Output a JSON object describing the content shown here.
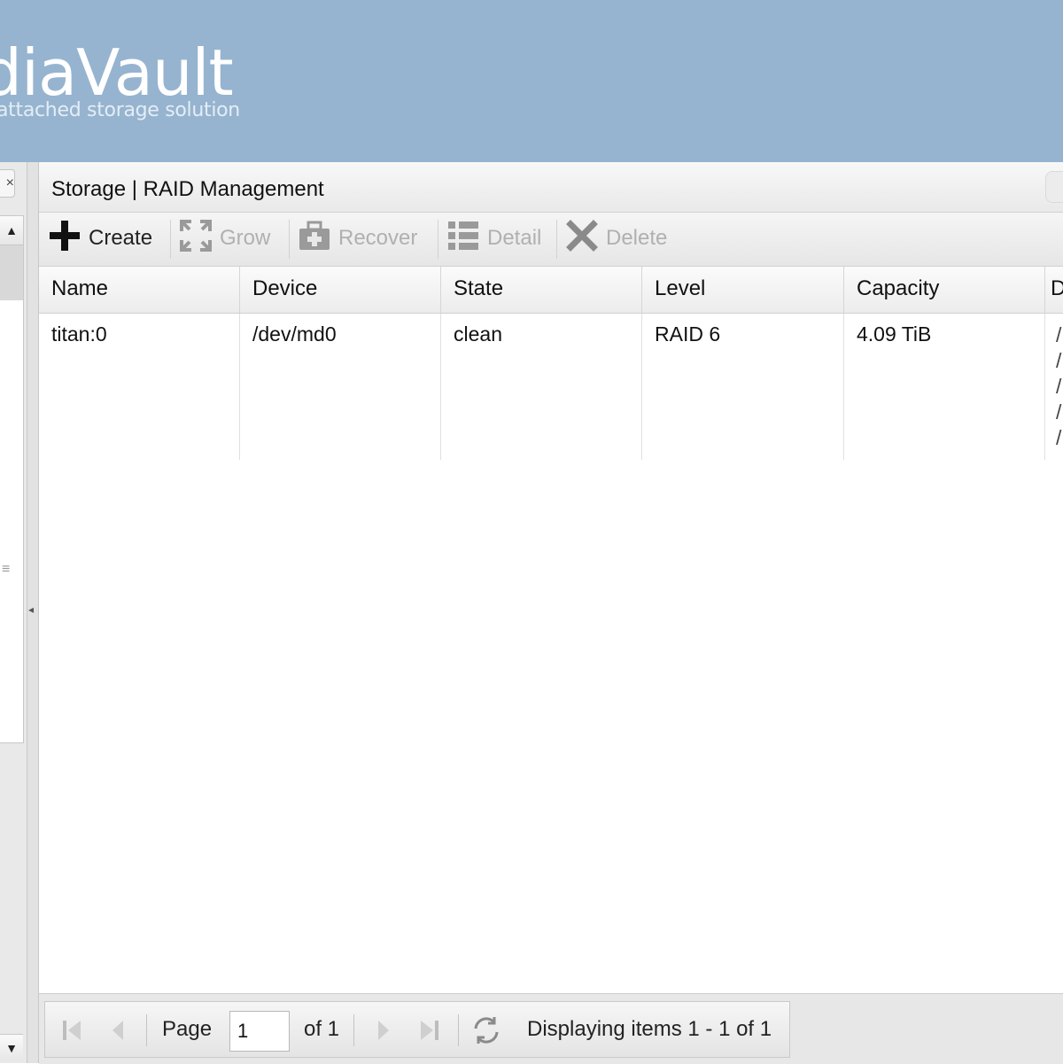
{
  "header": {
    "brand": "ediaVault",
    "tagline": "attached storage solution"
  },
  "sidebar": {
    "close_glyph": "×",
    "scroll_up_glyph": "▲",
    "scroll_down_glyph": "▼",
    "grip_glyph": "≡",
    "collapse_glyph": "◂"
  },
  "panel": {
    "title": "Storage | RAID Management",
    "toolbar": {
      "create": "Create",
      "grow": "Grow",
      "recover": "Recover",
      "detail": "Detail",
      "delete": "Delete"
    }
  },
  "grid": {
    "columns": [
      "Name",
      "Device",
      "State",
      "Level",
      "Capacity",
      "D"
    ],
    "rows": [
      {
        "name": "titan:0",
        "device": "/dev/md0",
        "state": "clean",
        "level": "RAID 6",
        "capacity": "4.09 TiB",
        "devices": [
          "/",
          "/",
          "/",
          "/",
          "/"
        ]
      }
    ]
  },
  "pager": {
    "page_label": "Page",
    "page_value": "1",
    "of_label": "of 1",
    "display_text": "Displaying items 1 - 1 of 1"
  }
}
